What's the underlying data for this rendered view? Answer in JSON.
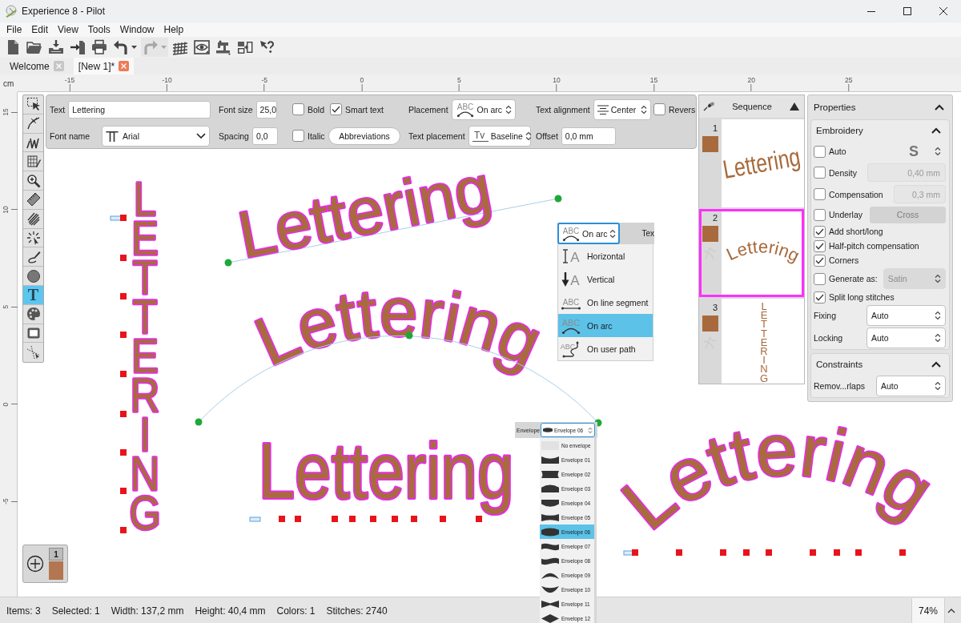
{
  "window": {
    "title": "Experience 8 - Pilot"
  },
  "menu": [
    "File",
    "Edit",
    "View",
    "Tools",
    "Window",
    "Help"
  ],
  "toolbar": [
    {
      "kind": "new",
      "disabled": false
    },
    {
      "kind": "open",
      "disabled": false
    },
    {
      "kind": "import",
      "disabled": false
    },
    {
      "kind": "merge",
      "disabled": false
    },
    {
      "kind": "print",
      "disabled": false
    },
    {
      "kind": "undo",
      "disabled": false,
      "menu": true
    },
    {
      "kind": "redo",
      "disabled": true,
      "menu": true
    },
    {
      "kind": "grid",
      "disabled": false
    },
    {
      "kind": "preview",
      "disabled": false
    },
    {
      "kind": "machine",
      "disabled": false
    },
    {
      "kind": "convert",
      "disabled": false
    },
    {
      "kind": "help",
      "disabled": false
    }
  ],
  "tabs": [
    {
      "label": "Welcome",
      "selected": false
    },
    {
      "label": "[New 1]*",
      "selected": true
    }
  ],
  "ruler": {
    "unit": "cm",
    "x_labels": [
      "-15",
      "-10",
      "-5",
      "0",
      "5",
      "10",
      "15",
      "20",
      "25"
    ],
    "y_labels": [
      "15",
      "10",
      "5",
      "0",
      "-5"
    ]
  },
  "tools": [
    {
      "kind": "select",
      "selected": false
    },
    {
      "kind": "bezier",
      "selected": false
    },
    {
      "kind": "stitch",
      "selected": false
    },
    {
      "kind": "digitize",
      "selected": false
    },
    {
      "kind": "zoom",
      "selected": false
    },
    {
      "kind": "measure",
      "selected": false
    },
    {
      "kind": "fill",
      "selected": false
    },
    {
      "kind": "burst",
      "selected": false
    },
    {
      "kind": "pen",
      "selected": false
    },
    {
      "kind": "circle",
      "selected": false
    },
    {
      "kind": "text",
      "glyph": "T",
      "selected": true
    },
    {
      "kind": "palette",
      "selected": false
    },
    {
      "kind": "hoop",
      "selected": false
    },
    {
      "kind": "split",
      "selected": false
    }
  ],
  "text_properties": {
    "text": {
      "label": "Text",
      "value": "Lettering"
    },
    "font_size": {
      "label": "Font size",
      "value": "25,0"
    },
    "bold": {
      "label": "Bold",
      "checked": false
    },
    "smart_text": {
      "label": "Smart text",
      "checked": true
    },
    "placement": {
      "label": "Placement",
      "value": "On arc",
      "kind": "arc",
      "glyph": "ABC"
    },
    "text_alignment": {
      "label": "Text alignment",
      "value": "Center"
    },
    "reverse": {
      "label": "Revers",
      "checked": false
    },
    "font_name": {
      "label": "Font name",
      "value": "Arial",
      "glyph": "TT"
    },
    "spacing": {
      "label": "Spacing",
      "value": "0,0"
    },
    "italic": {
      "label": "Italic",
      "checked": false
    },
    "abbreviations": {
      "label": "Abbreviations"
    },
    "text_placement": {
      "label": "Text placement",
      "value": "Baseline",
      "glyph": "Tv"
    },
    "offset": {
      "label": "Offset",
      "value": "0,0 mm"
    }
  },
  "canvas": {
    "objects": [
      {
        "kind": "vertical",
        "text": "LETTERING"
      },
      {
        "kind": "straight",
        "text": "Lettering"
      },
      {
        "kind": "arc",
        "text": "Lettering"
      },
      {
        "kind": "envelope",
        "text": "Lettering"
      },
      {
        "kind": "arc_steep",
        "text": "Lettering"
      }
    ]
  },
  "placement_menu": {
    "value": "On arc",
    "glyph": "ABC",
    "cut_label": "Tex",
    "options": [
      {
        "label": "Horizontal",
        "kind": "horizontal",
        "glyph": "A",
        "selected": false
      },
      {
        "label": "Vertical",
        "kind": "vertical",
        "glyph": "A",
        "selected": false
      },
      {
        "label": "On line segment",
        "kind": "segment",
        "glyph": "ABC",
        "selected": false
      },
      {
        "label": "On arc",
        "kind": "arc",
        "glyph": "ABC",
        "selected": true
      },
      {
        "label": "On user path",
        "kind": "path",
        "glyph": "ABC",
        "selected": false
      }
    ]
  },
  "envelope_menu": {
    "label": "Envelope",
    "value": "Envelope 06",
    "options": [
      {
        "label": "No envelope",
        "kind": "none",
        "selected": false
      },
      {
        "label": "Envelope 01",
        "kind": "valley",
        "selected": false
      },
      {
        "label": "Envelope 02",
        "kind": "pinch",
        "selected": false
      },
      {
        "label": "Envelope 03",
        "kind": "dome",
        "selected": false
      },
      {
        "label": "Envelope 04",
        "kind": "belly",
        "selected": false
      },
      {
        "label": "Envelope 05",
        "kind": "waist",
        "selected": false
      },
      {
        "label": "Envelope 06",
        "kind": "barrel",
        "selected": true
      },
      {
        "label": "Envelope 07",
        "kind": "wave",
        "selected": false
      },
      {
        "label": "Envelope 08",
        "kind": "wave_reverse",
        "selected": false
      },
      {
        "label": "Envelope 09",
        "kind": "arch",
        "selected": false
      },
      {
        "label": "Envelope 10",
        "kind": "bowl",
        "selected": false
      },
      {
        "label": "Envelope 11",
        "kind": "bowtie",
        "selected": false
      },
      {
        "label": "Envelope 12",
        "kind": "diamond",
        "selected": false
      }
    ]
  },
  "thread_palette": [
    {
      "number": "1",
      "color": "#b27650"
    }
  ],
  "sequence": {
    "title": "Sequence",
    "items": [
      {
        "number": "1",
        "color": "#a86a3c",
        "text": "Lettering",
        "kind": "straight",
        "stitch_icon": false,
        "selected": false
      },
      {
        "number": "2",
        "color": "#a86a3c",
        "text": "Lettering",
        "kind": "arc",
        "stitch_icon": true,
        "selected": true
      },
      {
        "number": "3",
        "color": "#a86a3c",
        "text": "LETTERING",
        "kind": "vertical",
        "stitch_icon": true,
        "selected": false
      }
    ]
  },
  "properties": {
    "title": "Properties",
    "expanded": true,
    "sections": [
      {
        "title": "Embroidery",
        "expanded": true,
        "rows": [
          {
            "kind": "check_stitch",
            "label": "Auto",
            "checked": false,
            "glyph": "S"
          },
          {
            "kind": "check_field",
            "label": "Density",
            "checked": false,
            "value": "0,40 mm",
            "disabled": true
          },
          {
            "kind": "check_field",
            "label": "Compensation",
            "checked": false,
            "value": "0,3 mm",
            "disabled": true
          },
          {
            "kind": "check_button",
            "label": "Underlay",
            "checked": false,
            "value": "Cross",
            "disabled": true
          },
          {
            "kind": "check",
            "label": "Add short/long",
            "checked": true
          },
          {
            "kind": "check",
            "label": "Half-pitch compensation",
            "checked": true
          },
          {
            "kind": "check",
            "label": "Corners",
            "checked": true
          },
          {
            "kind": "check_combo",
            "label": "Generate as:",
            "checked": false,
            "value": "Satin",
            "disabled": true
          },
          {
            "kind": "check",
            "label": "Split long stitches",
            "checked": true
          },
          {
            "kind": "combo",
            "label": "Fixing",
            "value": "Auto",
            "disabled": false
          },
          {
            "kind": "combo",
            "label": "Locking",
            "value": "Auto",
            "disabled": false
          }
        ]
      },
      {
        "title": "Constraints",
        "expanded": true,
        "rows": [
          {
            "kind": "combo",
            "label": "Remov...rlaps",
            "value": "Auto",
            "disabled": false
          }
        ]
      }
    ]
  },
  "status_bar": {
    "items": [
      "Items: 3",
      "Selected: 1",
      "Width: 137,2 mm",
      "Height: 40,4 mm",
      "Colors: 1",
      "Stitches: 2740"
    ],
    "zoom": "74%"
  }
}
